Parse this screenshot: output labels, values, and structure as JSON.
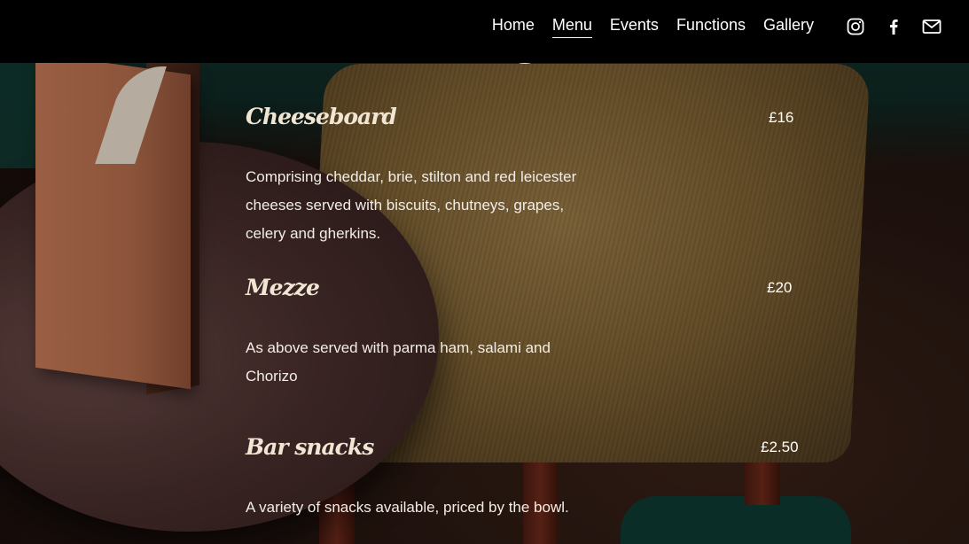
{
  "nav": {
    "items": [
      {
        "label": "Home",
        "active": false
      },
      {
        "label": "Menu",
        "active": true
      },
      {
        "label": "Events",
        "active": false
      },
      {
        "label": "Functions",
        "active": false
      },
      {
        "label": "Gallery",
        "active": false
      }
    ],
    "social_icons": [
      "instagram-icon",
      "facebook-icon",
      "mail-icon"
    ]
  },
  "menu": {
    "items": [
      {
        "name": "Cheeseboard",
        "price": "£16",
        "description": "Comprising cheddar, brie, stilton and red leicester cheeses served with biscuits, chutneys, grapes, celery and gherkins."
      },
      {
        "name": "Mezze",
        "price": "£20",
        "description": "As above served with parma ham, salami and Chorizo"
      },
      {
        "name": "Bar snacks",
        "price": "£2.50",
        "description": "A variety of snacks available, priced by the bowl."
      }
    ]
  },
  "colors": {
    "header_bg": "#000000",
    "item_name": "#f1e6d3",
    "text": "#f3ede6"
  }
}
